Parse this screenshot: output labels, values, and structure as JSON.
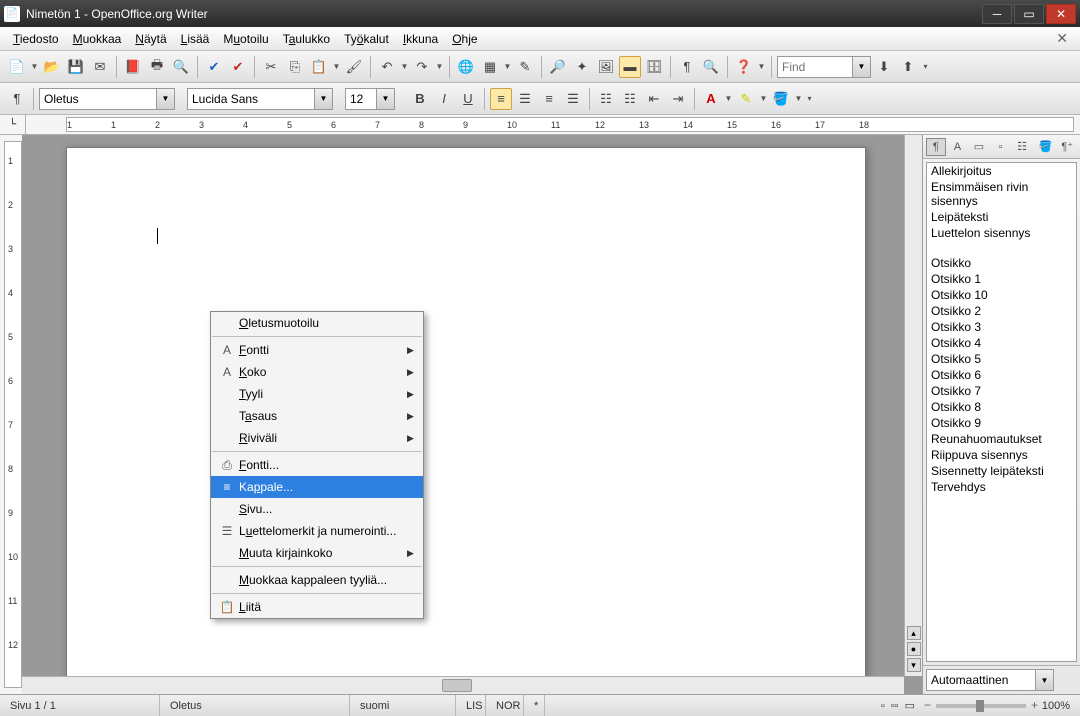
{
  "window": {
    "title": "Nimetön 1 - OpenOffice.org Writer"
  },
  "menu": {
    "items": [
      "Tiedosto",
      "Muokkaa",
      "Näytä",
      "Lisää",
      "Muotoilu",
      "Taulukko",
      "Työkalut",
      "Ikkuna",
      "Ohje"
    ]
  },
  "toolbar1": {
    "find_placeholder": "Find"
  },
  "toolbar2": {
    "style": "Oletus",
    "font": "Lucida Sans",
    "size": "12"
  },
  "ruler": {
    "labels": [
      "1",
      "1",
      "2",
      "3",
      "4",
      "5",
      "6",
      "7",
      "8",
      "9",
      "10",
      "11",
      "12",
      "13",
      "14",
      "15",
      "16",
      "17",
      "18"
    ]
  },
  "context_menu": {
    "items": [
      {
        "label": "Oletusmuotoilu",
        "u": 0,
        "icon": "",
        "arrow": false
      },
      {
        "sep": true
      },
      {
        "label": "Fontti",
        "u": 0,
        "icon": "A",
        "arrow": true
      },
      {
        "label": "Koko",
        "u": 0,
        "icon": "A",
        "arrow": true
      },
      {
        "label": "Tyyli",
        "u": 0,
        "icon": "",
        "arrow": true
      },
      {
        "label": "Tasaus",
        "u": 1,
        "icon": "",
        "arrow": true
      },
      {
        "label": "Riviväli",
        "u": 0,
        "icon": "",
        "arrow": true
      },
      {
        "sep": true
      },
      {
        "label": "Fontti...",
        "u": 0,
        "icon": "⎙",
        "arrow": false
      },
      {
        "label": "Kappale...",
        "u": 2,
        "icon": "≡",
        "arrow": false,
        "hover": true
      },
      {
        "label": "Sivu...",
        "u": 0,
        "icon": "",
        "arrow": false
      },
      {
        "label": "Luettelomerkit ja numerointi...",
        "u": 1,
        "icon": "☰",
        "arrow": false
      },
      {
        "label": "Muuta kirjainkoko",
        "u": 0,
        "icon": "",
        "arrow": true
      },
      {
        "sep": true
      },
      {
        "label": "Muokkaa kappaleen tyyliä...",
        "u": 0,
        "icon": "",
        "arrow": false
      },
      {
        "sep": true
      },
      {
        "label": "Liitä",
        "u": 0,
        "icon": "📋",
        "arrow": false
      }
    ]
  },
  "sidebar": {
    "styles": [
      "Allekirjoitus",
      "Ensimmäisen rivin sisennys",
      "Leipäteksti",
      "Luettelon sisennys",
      "",
      "Otsikko",
      "Otsikko 1",
      "Otsikko 10",
      "Otsikko 2",
      "Otsikko 3",
      "Otsikko 4",
      "Otsikko 5",
      "Otsikko 6",
      "Otsikko 7",
      "Otsikko 8",
      "Otsikko 9",
      "Reunahuomautukset",
      "Riippuva sisennys",
      "Sisennetty leipäteksti",
      "Tervehdys"
    ],
    "combo": "Automaattinen"
  },
  "status": {
    "page": "Sivu 1 / 1",
    "style": "Oletus",
    "lang": "suomi",
    "ins": "LIS",
    "std": "NOR",
    "mod": "*",
    "zoom": "100%"
  }
}
